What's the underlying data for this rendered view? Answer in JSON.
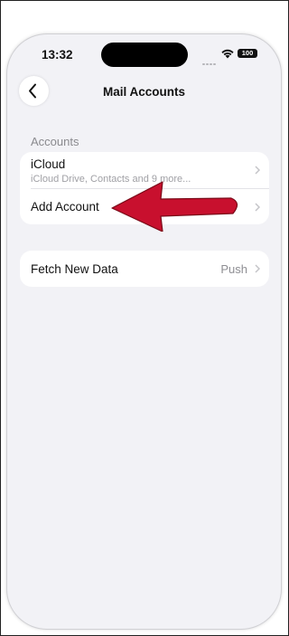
{
  "status_bar": {
    "time": "13:32",
    "battery": "100"
  },
  "nav": {
    "title": "Mail Accounts"
  },
  "accounts_section": {
    "header": "Accounts",
    "items": [
      {
        "label": "iCloud",
        "subtitle": "iCloud Drive, Contacts and 9 more..."
      },
      {
        "label": "Add Account"
      }
    ]
  },
  "fetch_section": {
    "label": "Fetch New Data",
    "value": "Push"
  },
  "colors": {
    "annotation_arrow": "#c8102e",
    "background": "#f2f2f6"
  }
}
